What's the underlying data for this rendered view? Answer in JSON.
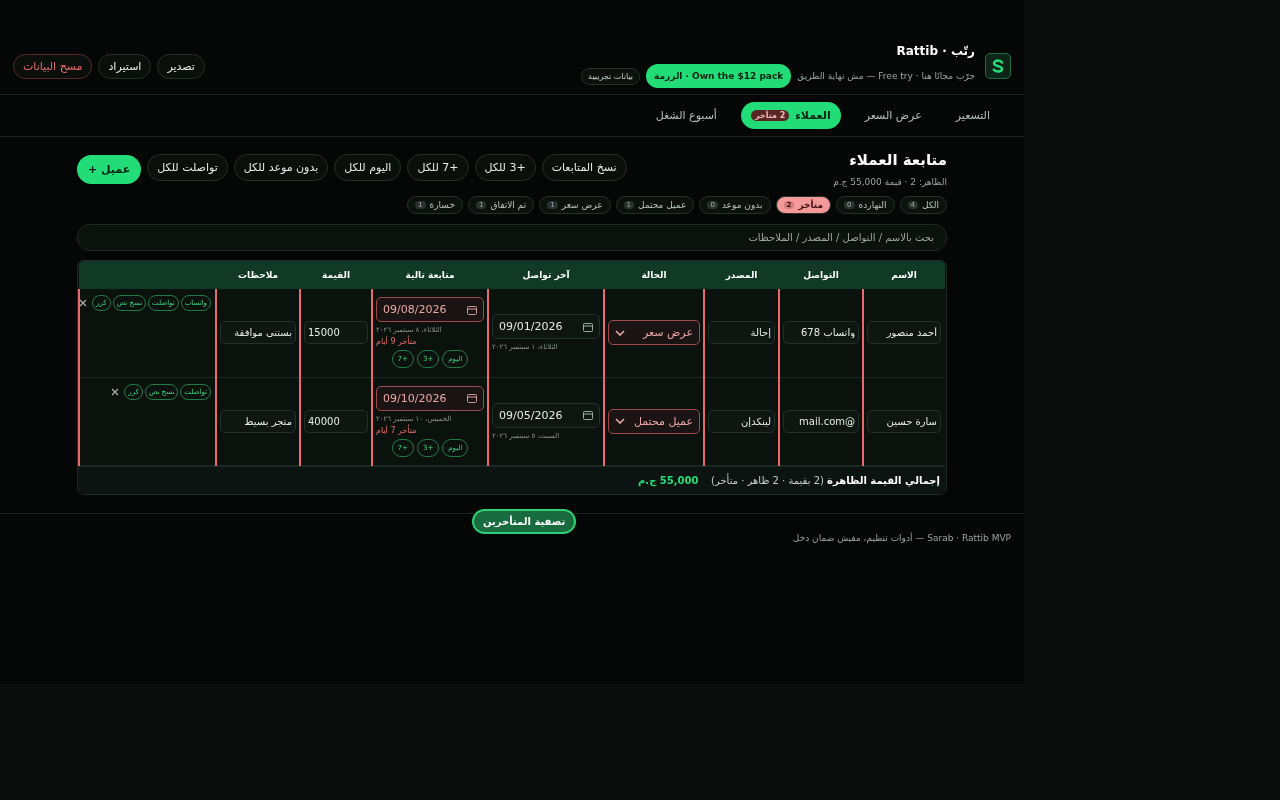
{
  "brand": {
    "title": "رتّب · Rattib",
    "tagline": "جرّب مجانًا هنا · Free try — مش نهاية الطريق",
    "promo": "Own the $12 pack · الرزمة",
    "badge": "بيانات تجريبية"
  },
  "header_actions": [
    {
      "label": "تصدير",
      "kind": "normal"
    },
    {
      "label": "استيراد",
      "kind": "normal"
    },
    {
      "label": "مسح البيانات",
      "kind": "danger"
    }
  ],
  "tabs": [
    {
      "label": "التسعير",
      "selected": false
    },
    {
      "label": "عرض السعر",
      "selected": false
    },
    {
      "label": "العملاء",
      "selected": true,
      "badge": "2 متأخر"
    },
    {
      "label": "أسبوع الشغل",
      "selected": false
    }
  ],
  "page": {
    "title": "متابعة العملاء",
    "summary": "الظاهر: 2 · قيمة 55,000 ج.م",
    "add_button": "عميل +"
  },
  "bulk_actions": [
    "نسخ المتابعات",
    "+3 للكل",
    "+7 للكل",
    "اليوم للكل",
    "بدون موعد للكل",
    "تواصلت للكل"
  ],
  "filters": [
    {
      "label": "الكل",
      "count": "4",
      "selected": false
    },
    {
      "label": "النهارده",
      "count": "0",
      "selected": false
    },
    {
      "label": "متأخر",
      "count": "2",
      "selected": true
    },
    {
      "label": "بدون موعد",
      "count": "0",
      "selected": false
    },
    {
      "label": "عميل محتمل",
      "count": "1",
      "selected": false
    },
    {
      "label": "عرض سعر",
      "count": "1",
      "selected": false
    },
    {
      "label": "تم الاتفاق",
      "count": "1",
      "selected": false
    },
    {
      "label": "خسارة",
      "count": "1",
      "selected": false
    }
  ],
  "search": {
    "placeholder": "بحث بالاسم / التواصل / المصدر / الملاحظات"
  },
  "table": {
    "columns": [
      "الاسم",
      "التواصل",
      "المصدر",
      "الحالة",
      "آخر تواصل",
      "متابعة تالية",
      "القيمة",
      "ملاحظات"
    ],
    "rows": [
      {
        "name": "أحمد منصور",
        "contact": "واتساب 678",
        "source": "إحالة",
        "status": "عرض سعر",
        "last_contact": "09/01/2026",
        "last_contact_day": "الثلاثاء، ١ سبتمبر ٢٠٢٦",
        "next_follow": "09/08/2026",
        "next_follow_day": "الثلاثاء، ٨ سبتمبر ٢٠٢٦",
        "overdue": true,
        "overdue_text": "متأخر 9 أيام",
        "quick": [
          "اليوم",
          "+3",
          "+7"
        ],
        "value": "15000",
        "notes": "بستنى موافقة",
        "actions": [
          "واتساب",
          "تواصلت",
          "نسخ نص",
          "كرر"
        ]
      },
      {
        "name": "سارة حسين",
        "contact": "@mail.com",
        "source": "لينكدإن",
        "status": "عميل محتمل",
        "last_contact": "09/05/2026",
        "last_contact_day": "السبت، ٥ سبتمبر ٢٠٢٦",
        "next_follow": "09/10/2026",
        "next_follow_day": "الخميس، ١٠ سبتمبر ٢٠٢٦",
        "overdue": true,
        "overdue_text": "متأخر 7 أيام",
        "quick": [
          "اليوم",
          "+3",
          "+7"
        ],
        "value": "40000",
        "notes": "متجر بسيط",
        "actions": [
          "تواصلت",
          "نسخ نص",
          "كرر"
        ]
      }
    ],
    "total_label": "**إجمالي القيمة الظاهرة** (2 بقيمة · 2 ظاهر · متأخر)",
    "total_value": "55,000 ج.م"
  },
  "floating_button": "تصفية المتأخرين",
  "footer": "Sarab · Rattib MVP — أدوات تنظيم، مفيش ضمان دخل"
}
